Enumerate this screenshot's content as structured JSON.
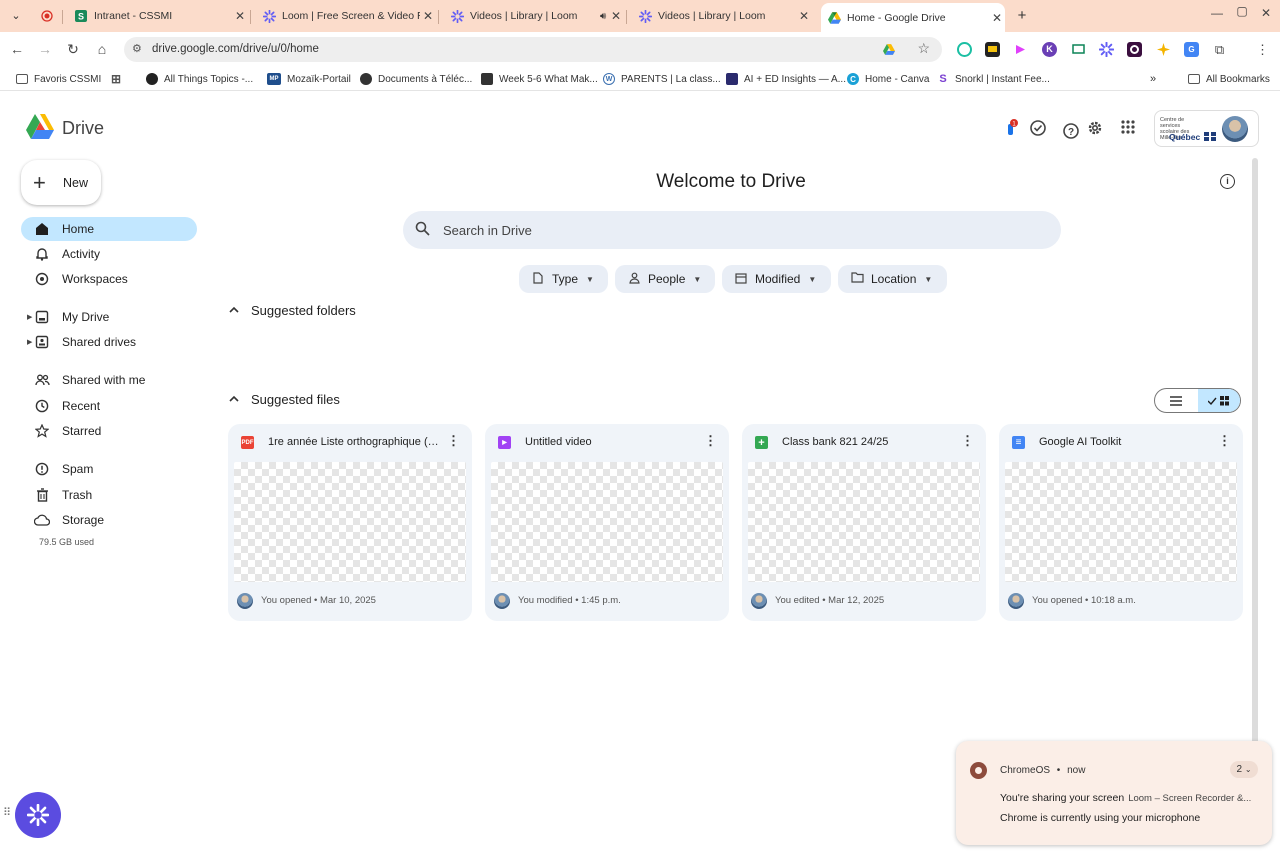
{
  "browser": {
    "tabs": [
      {
        "title": "",
        "icon": "record-icon",
        "color": "#d93025"
      },
      {
        "title": "Intranet - CSSMI",
        "icon": "s-logo-icon",
        "color": "#1a8a5a"
      },
      {
        "title": "Loom | Free Screen & Video Re",
        "icon": "loom-icon",
        "color": "#625df5"
      },
      {
        "title": "Videos | Library | Loom",
        "icon": "loom-icon",
        "color": "#625df5"
      },
      {
        "title": "Videos | Library | Loom",
        "icon": "loom-icon",
        "color": "#625df5"
      },
      {
        "title": "Home - Google Drive",
        "icon": "google-drive-icon",
        "color": "#1a73e8"
      }
    ],
    "url": "drive.google.com/drive/u/0/home",
    "bookmarks": [
      {
        "label": "Favoris CSSMI",
        "icon": "folder-icon",
        "color": "#555555"
      },
      {
        "label": "",
        "icon": "apps-grid-icon",
        "color": "#555555"
      },
      {
        "label": "All Things Topics -...",
        "icon": "circle-logo-icon",
        "color": "#222222"
      },
      {
        "label": "Mozaïk-Portail",
        "icon": "mp-logo-icon",
        "color": "#1f4e8c"
      },
      {
        "label": "Documents à Téléc...",
        "icon": "globe-icon",
        "color": "#333333"
      },
      {
        "label": "Week 5-6 What Mak...",
        "icon": "camera-icon",
        "color": "#333333"
      },
      {
        "label": "PARENTS | La class...",
        "icon": "wordpress-icon",
        "color": "#3a6fb0"
      },
      {
        "label": "AI + ED Insights — A...",
        "icon": "ai-ed-icon",
        "color": "#2b2b6e"
      },
      {
        "label": "Home - Canva",
        "icon": "canva-icon",
        "color": "#1aa1d6"
      },
      {
        "label": "Snorkl | Instant Fee...",
        "icon": "snorkl-icon",
        "color": "#7a3fd1"
      }
    ],
    "all_bookmarks": "All Bookmarks"
  },
  "drive": {
    "app_name": "Drive",
    "new_label": "New",
    "org_text": "Centre de services scolaire des Mille-Îles",
    "org_name": "Québec",
    "notification_count": "1",
    "nav": [
      {
        "label": "Home",
        "icon": "home-icon"
      },
      {
        "label": "Activity",
        "icon": "bell-icon"
      },
      {
        "label": "Workspaces",
        "icon": "workspaces-icon"
      },
      {
        "label": "My Drive",
        "icon": "my-drive-icon"
      },
      {
        "label": "Shared drives",
        "icon": "shared-drives-icon"
      },
      {
        "label": "Shared with me",
        "icon": "people-icon"
      },
      {
        "label": "Recent",
        "icon": "clock-icon"
      },
      {
        "label": "Starred",
        "icon": "star-icon"
      },
      {
        "label": "Spam",
        "icon": "spam-icon"
      },
      {
        "label": "Trash",
        "icon": "trash-icon"
      },
      {
        "label": "Storage",
        "icon": "cloud-icon"
      }
    ],
    "storage_used": "79.5 GB used",
    "welcome": "Welcome to Drive",
    "search_placeholder": "Search in Drive",
    "filters": [
      {
        "label": "Type",
        "icon": "file-icon"
      },
      {
        "label": "People",
        "icon": "person-icon"
      },
      {
        "label": "Modified",
        "icon": "calendar-icon"
      },
      {
        "label": "Location",
        "icon": "folder-icon"
      }
    ],
    "suggested_folders": "Suggested folders",
    "suggested_files": "Suggested files",
    "files": [
      {
        "name": "1re année Liste orthographique (m...",
        "type": "pdf",
        "type_label": "PDF",
        "color": "#ea4335",
        "meta": "You opened • Mar 10, 2025"
      },
      {
        "name": "Untitled video",
        "type": "video",
        "type_label": "▶",
        "color": "#a142f4",
        "meta": "You modified • 1:45 p.m."
      },
      {
        "name": "Class bank 821 24/25",
        "type": "sheets",
        "type_label": "+",
        "color": "#34a853",
        "meta": "You edited • Mar 12, 2025"
      },
      {
        "name": "Google AI Toolkit",
        "type": "docs",
        "type_label": "≡",
        "color": "#4285f4",
        "meta": "You opened • 10:18 a.m."
      }
    ]
  },
  "notification": {
    "source": "ChromeOS",
    "time": "now",
    "count": "2",
    "line1": "You're sharing your screen",
    "line1_sub": "Loom – Screen Recorder &...",
    "line2": "Chrome is currently using your microphone"
  },
  "colors": {
    "accent": "#c2e7ff",
    "search_bg": "#e9eef6",
    "tabstrip": "#fbdccb"
  }
}
